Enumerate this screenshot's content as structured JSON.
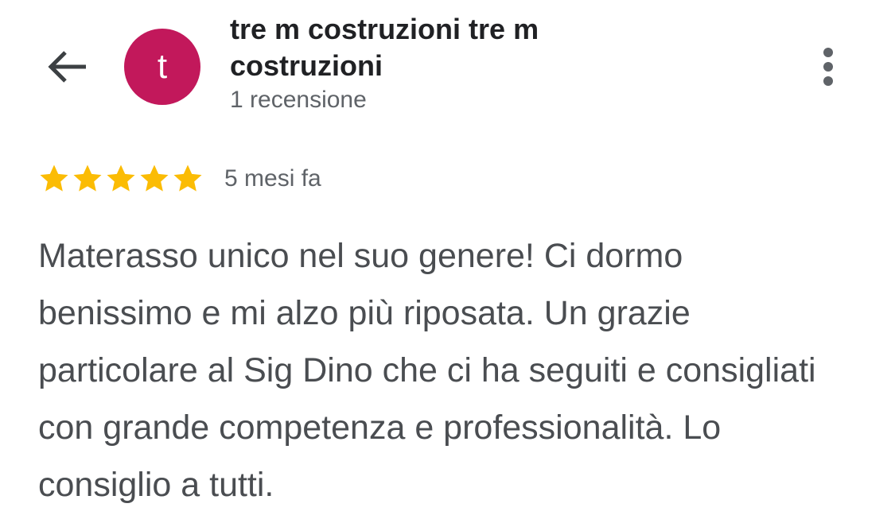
{
  "header": {
    "back_icon": "arrow-back-icon",
    "avatar_letter": "t",
    "avatar_color": "#c2185b",
    "reviewer_name": "tre m costruzioni tre m costruzioni",
    "review_count": "1 recensione",
    "more_icon": "more-vert-icon"
  },
  "review": {
    "rating": 5,
    "max_rating": 5,
    "star_color": "#fbbc04",
    "time_ago": "5 mesi fa",
    "text": "Materasso unico nel suo genere! Ci dormo benissimo e mi alzo più riposata. Un grazie particolare al Sig Dino che ci ha seguiti e consigliati con grande competenza e professionalità. Lo consiglio a tutti."
  }
}
